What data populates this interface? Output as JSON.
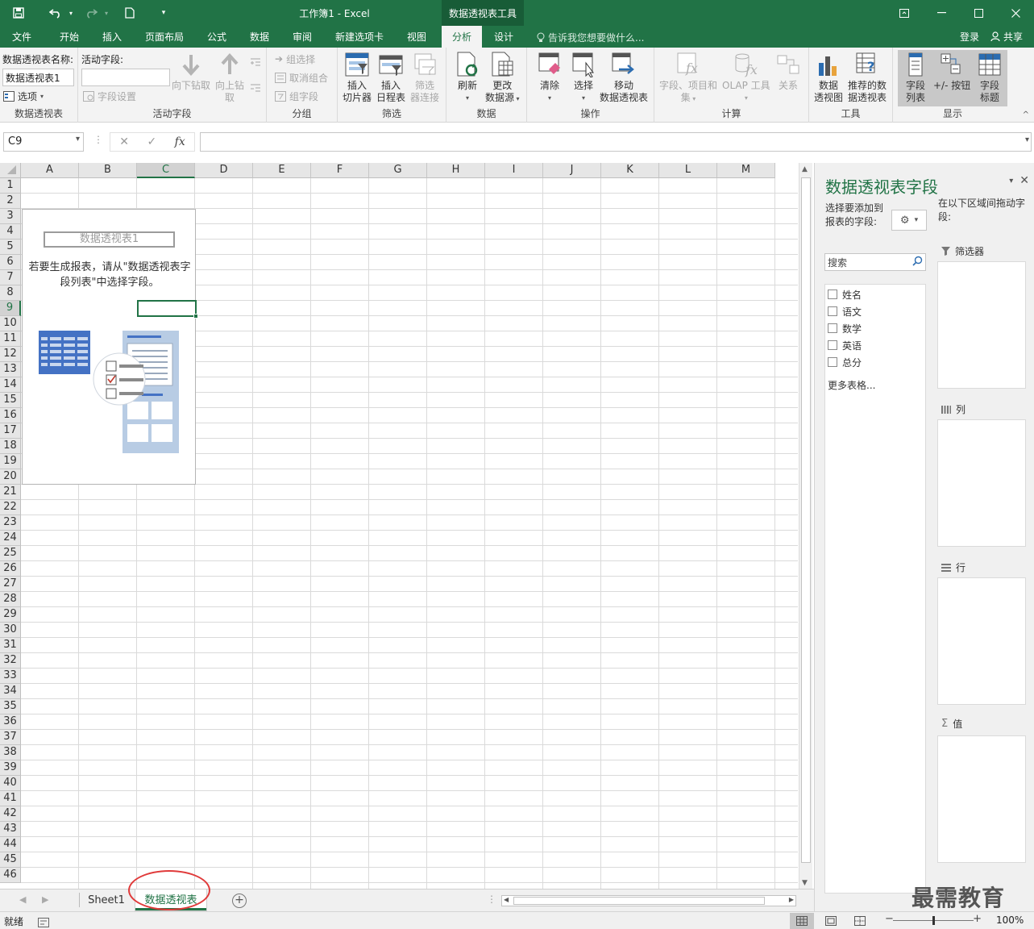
{
  "titlebar": {
    "doc_title": "工作簿1 - Excel",
    "context_tool": "数据透视表工具"
  },
  "tabs": {
    "items": [
      "文件",
      "开始",
      "插入",
      "页面布局",
      "公式",
      "数据",
      "审阅",
      "新建选项卡",
      "视图",
      "分析",
      "设计"
    ],
    "active": "分析",
    "tell_me": "告诉我您想要做什么...",
    "login": "登录",
    "share": "共享"
  },
  "ribbon": {
    "pivot_name_label": "数据透视表名称:",
    "pivot_name_value": "数据透视表1",
    "options": "选项",
    "group_pivot": "数据透视表",
    "active_field_label": "活动字段:",
    "field_settings": "字段设置",
    "drill_down": "向下钻取",
    "drill_up_1": "向上钻",
    "drill_up_2": "取",
    "group_active_field": "活动字段",
    "group_selection": "组选择",
    "ungroup": "取消组合",
    "group_field": "组字段",
    "group_group": "分组",
    "insert_slicer_1": "插入",
    "insert_slicer_2": "切片器",
    "insert_timeline_1": "插入",
    "insert_timeline_2": "日程表",
    "filter_conn_1": "筛选",
    "filter_conn_2": "器连接",
    "group_filter": "筛选",
    "refresh": "刷新",
    "change_source_1": "更改",
    "change_source_2": "数据源",
    "group_data": "数据",
    "clear": "清除",
    "select": "选择",
    "move_1": "移动",
    "move_2": "数据透视表",
    "group_actions": "操作",
    "fields_items_1": "字段、项目和",
    "fields_items_2": "集",
    "olap": "OLAP 工具",
    "relations": "关系",
    "group_calc": "计算",
    "pivot_chart_1": "数据",
    "pivot_chart_2": "透视图",
    "recommended_1": "推荐的数",
    "recommended_2": "据透视表",
    "group_tools": "工具",
    "field_list_1": "字段",
    "field_list_2": "列表",
    "buttons": "+/- 按钮",
    "field_headers_1": "字段",
    "field_headers_2": "标题",
    "group_show": "显示"
  },
  "formula_bar": {
    "name_box": "C9",
    "cancel": "✕",
    "enter": "✓",
    "fx": "fx",
    "formula": ""
  },
  "grid": {
    "columns": [
      "A",
      "B",
      "C",
      "D",
      "E",
      "F",
      "G",
      "H",
      "I",
      "J",
      "K",
      "L",
      "M"
    ],
    "active_column": "C",
    "rows": [
      "1",
      "2",
      "3",
      "4",
      "5",
      "6",
      "7",
      "8",
      "9",
      "10",
      "11",
      "12",
      "13",
      "14",
      "15",
      "16",
      "17",
      "18",
      "19",
      "20",
      "21",
      "22",
      "23",
      "24",
      "25",
      "26",
      "27",
      "28",
      "29",
      "30",
      "31",
      "32",
      "33",
      "34",
      "35",
      "36",
      "37",
      "38",
      "39",
      "40",
      "41",
      "42",
      "43",
      "44",
      "45",
      "46"
    ],
    "active_row": "9",
    "pivot_placeholder_title": "数据透视表1",
    "pivot_placeholder_msg": "若要生成报表，请从\"数据透视表字段列表\"中选择字段。"
  },
  "sheets": {
    "tabs": [
      "Sheet1",
      "数据透视表"
    ],
    "active": "数据透视表"
  },
  "status": {
    "ready": "就绪",
    "zoom": "100%",
    "zoom_fraction": 0.5
  },
  "pane": {
    "title": "数据透视表字段",
    "choose_text": "选择要添加到报表的字段:",
    "drag_text": "在以下区域间拖动字段:",
    "search_placeholder": "搜索",
    "fields": [
      "姓名",
      "语文",
      "数学",
      "英语",
      "总分"
    ],
    "more_tables": "更多表格...",
    "areas": {
      "filters": "筛选器",
      "columns": "列",
      "rows": "行",
      "values": "值"
    }
  },
  "watermark": "最需教育",
  "colors": {
    "accent": "#217346",
    "annotation": "#e03a3a"
  }
}
